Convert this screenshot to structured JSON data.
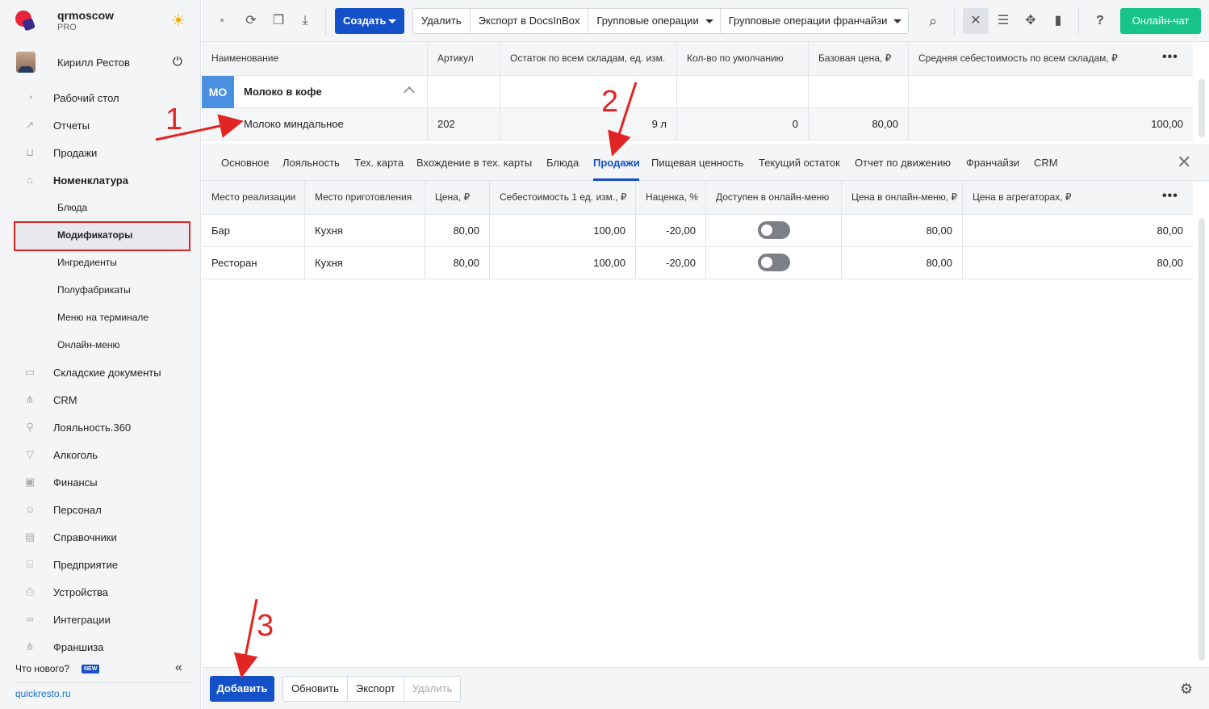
{
  "brand": {
    "name": "qrmoscow",
    "plan": "PRO"
  },
  "user": {
    "name": "Кирилл Рестов"
  },
  "sidebar": {
    "items": [
      {
        "label": "Рабочий стол",
        "icon": "gauge-icon"
      },
      {
        "label": "Отчеты",
        "icon": "chart-icon"
      },
      {
        "label": "Продажи",
        "icon": "basket-icon"
      },
      {
        "label": "Номенклатура",
        "icon": "tag-icon"
      },
      {
        "label": "Складские документы",
        "icon": "archive-icon"
      },
      {
        "label": "CRM",
        "icon": "hierarchy-icon"
      },
      {
        "label": "Лояльность.360",
        "icon": "loyalty-icon"
      },
      {
        "label": "Алкоголь",
        "icon": "cocktail-icon"
      },
      {
        "label": "Финансы",
        "icon": "wallet-icon"
      },
      {
        "label": "Персонал",
        "icon": "people-icon"
      },
      {
        "label": "Справочники",
        "icon": "book-icon"
      },
      {
        "label": "Предприятие",
        "icon": "store-icon"
      },
      {
        "label": "Устройства",
        "icon": "printer-icon"
      },
      {
        "label": "Интеграции",
        "icon": "infinity-icon"
      },
      {
        "label": "Франшиза",
        "icon": "network-icon"
      }
    ],
    "subitems": [
      "Блюда",
      "Модификаторы",
      "Ингредиенты",
      "Полуфабрикаты",
      "Меню на терминале",
      "Онлайн-меню"
    ],
    "whats_new": "Что нового?",
    "new_badge": "NEW",
    "site": "quickresto.ru"
  },
  "toolbar": {
    "create": "Создать",
    "buttons": [
      "Удалить",
      "Экспорт в DocsInBox",
      "Групповые операции",
      "Групповые операции франчайзи"
    ],
    "chat": "Онлайн-чат"
  },
  "top_grid": {
    "headers": [
      "Наименование",
      "Артикул",
      "Остаток по всем складам, ед. изм.",
      "Кол-во по умолчанию",
      "Базовая цена, ₽",
      "Средняя себестоимость по всем складам, ₽"
    ],
    "group": {
      "tile": "МО",
      "name": "Молоко в кофе"
    },
    "row": [
      "Молоко миндальное",
      "202",
      "9 л",
      "0",
      "80,00",
      "100,00"
    ]
  },
  "tabs": [
    "Основное",
    "Лояльность",
    "Тех. карта",
    "Вхождение в тех. карты",
    "Блюда",
    "Продажи",
    "Пищевая ценность",
    "Текущий остаток",
    "Отчет по движению",
    "Франчайзи",
    "CRM"
  ],
  "sales_grid": {
    "headers": [
      "Место реализации",
      "Место приготовления",
      "Цена, ₽",
      "Себестоимость 1 ед. изм., ₽",
      "Наценка, %",
      "Доступен в онлайн-меню",
      "Цена в онлайн-меню, ₽",
      "Цена в агрегаторах, ₽"
    ],
    "rows": [
      {
        "place": "Бар",
        "kitchen": "Кухня",
        "price": "80,00",
        "cost": "100,00",
        "markup": "-20,00",
        "online": false,
        "online_price": "80,00",
        "agg_price": "80,00"
      },
      {
        "place": "Ресторан",
        "kitchen": "Кухня",
        "price": "80,00",
        "cost": "100,00",
        "markup": "-20,00",
        "online": false,
        "online_price": "80,00",
        "agg_price": "80,00"
      }
    ]
  },
  "bottom": {
    "add": "Добавить",
    "refresh": "Обновить",
    "export": "Экспорт",
    "delete": "Удалить"
  },
  "annotations": [
    "1",
    "2",
    "3"
  ],
  "colors": {
    "accent": "#1450c8",
    "chat": "#19c489",
    "annotation": "#e12424",
    "tile": "#4a8fe0"
  }
}
